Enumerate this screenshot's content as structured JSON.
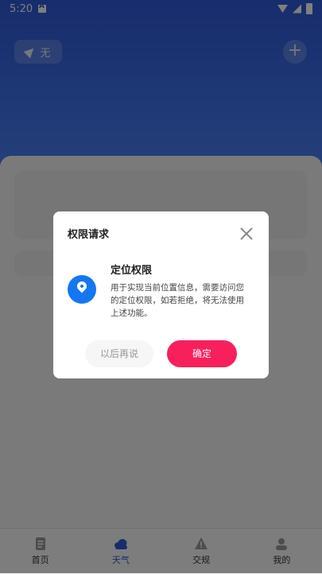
{
  "status_bar": {
    "time": "5:20"
  },
  "header": {
    "location_label": "无"
  },
  "tabs": [
    {
      "label": "首页"
    },
    {
      "label": "天气"
    },
    {
      "label": "交规"
    },
    {
      "label": "我的"
    }
  ],
  "dialog": {
    "title": "权限请求",
    "permission_title": "定位权限",
    "permission_desc": "用于实现当前位置信息，需要访问您的定位权限，如若拒绝，将无法使用上述功能。",
    "later_label": "以后再说",
    "ok_label": "确定"
  },
  "colors": {
    "header_blue": "#2f59d9",
    "accent_pink": "#f81f5d",
    "badge_blue": "#1576f2",
    "tab_active": "#2e5bd8"
  },
  "icons": [
    "navigation-icon",
    "add-icon",
    "home-doc-icon",
    "weather-cloud-icon",
    "warning-icon",
    "user-icon",
    "close-icon",
    "location-pin-icon"
  ]
}
